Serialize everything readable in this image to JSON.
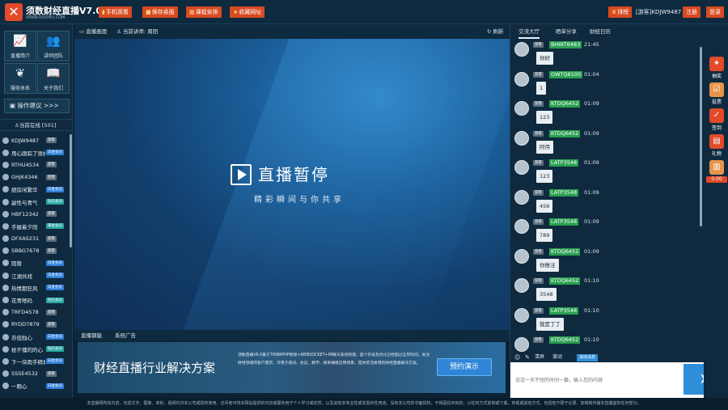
{
  "app": {
    "title": "须数财经直播V7.0",
    "subtitle": "WWW.IXUSHU.COM"
  },
  "topbar": {
    "buttons": [
      {
        "icon": "mobile-icon",
        "label": "手机观看"
      },
      {
        "icon": "save-icon",
        "label": "保存桌面"
      },
      {
        "icon": "calendar-icon",
        "label": "课程安排"
      },
      {
        "icon": "star-icon",
        "label": "收藏网址"
      }
    ],
    "rank_label": "排榜",
    "guest_name": "[游客]KDJW9487",
    "register_label": "注册",
    "login_label": "登录"
  },
  "sidebar": {
    "tiles": [
      {
        "icon": "chart-icon",
        "label": "直播简介"
      },
      {
        "icon": "team-icon",
        "label": "讲师团队"
      },
      {
        "icon": "service-icon",
        "label": "服务体系"
      },
      {
        "icon": "book-icon",
        "label": "关于我们"
      }
    ],
    "suggest_label": "操作建议 >>>",
    "online_label": "当前在线 [501]",
    "users": [
      {
        "name": "KDJW9487",
        "badge": "游客",
        "type": "guest"
      },
      {
        "name": "用心跟踪了很好",
        "badge": "白金会员",
        "type": "vip"
      },
      {
        "name": "RTHU4534",
        "badge": "游客",
        "type": "guest"
      },
      {
        "name": "GHJK4346",
        "badge": "游客",
        "type": "guest"
      },
      {
        "name": "厨房闲繁华",
        "badge": "白金会员",
        "type": "vip"
      },
      {
        "name": "副性与青气",
        "badge": "钻石会员",
        "type": "gold"
      },
      {
        "name": "HBF12342",
        "badge": "游客",
        "type": "guest"
      },
      {
        "name": "手握着夕阳",
        "badge": "黄金会员",
        "type": "gold"
      },
      {
        "name": "DFXAS231",
        "badge": "游客",
        "type": "guest"
      },
      {
        "name": "SBBG7678",
        "badge": "游客",
        "type": "guest"
      },
      {
        "name": "陌陵",
        "badge": "白金会员",
        "type": "vip"
      },
      {
        "name": "江湖共戏",
        "badge": "白金会员",
        "type": "vip"
      },
      {
        "name": "热情期狂风",
        "badge": "白金会员",
        "type": "vip"
      },
      {
        "name": "花青嗯码",
        "badge": "钻石会员",
        "type": "gold"
      },
      {
        "name": "TRFD4578",
        "badge": "游客",
        "type": "guest"
      },
      {
        "name": "RYDD7879",
        "badge": "游客",
        "type": "guest"
      },
      {
        "name": "亦但独心",
        "badge": "白金会员",
        "type": "vip"
      },
      {
        "name": "枕不懂的的心",
        "badge": "钻石会员",
        "type": "gold"
      },
      {
        "name": "下一块雨手精城",
        "badge": "白金会员",
        "type": "vip"
      },
      {
        "name": "SSSE4532",
        "badge": "游客",
        "type": "guest"
      },
      {
        "name": "一颗心",
        "badge": "白金会员",
        "type": "vip"
      }
    ]
  },
  "video": {
    "tab_label": "直播画面",
    "lecturer_label": "当前讲师:",
    "lecturer_name": "周阳",
    "refresh_label": "刷新",
    "paused_title": "直播暂停",
    "paused_subtitle": "精彩瞬间与你共享"
  },
  "bottom_tabs": [
    "直播钢能",
    "系统广告"
  ],
  "banner": {
    "title": "财经直播行业解决方案",
    "description": "须数直播V6.0基于THINKPHP框架+WEBSOCKET+IM聊天系统构建，是个开发及优化已经超过五年时间，关注财经领域的客户需求，可用于培训、会议、教学、喊单播报应用场景，提供灵活易用的财经直播解决方案。",
    "button_label": "预约演示"
  },
  "chat": {
    "tabs": [
      "交流大厅",
      "晒单分享",
      "财经日历"
    ],
    "messages": [
      {
        "tag": "游客",
        "name": "BHWT6483",
        "time": "21:45",
        "text": "你好"
      },
      {
        "tag": "游客",
        "name": "OWTQ8100",
        "time": "01:04",
        "text": "1"
      },
      {
        "tag": "游客",
        "name": "KTDQ6452",
        "time": "01:09",
        "text": "123"
      },
      {
        "tag": "游客",
        "name": "KTDQ6452",
        "time": "01:09",
        "text": "阿伟"
      },
      {
        "tag": "游客",
        "name": "LATP3548",
        "time": "01:09",
        "text": "123"
      },
      {
        "tag": "游客",
        "name": "LATP3548",
        "time": "01:09",
        "text": "456"
      },
      {
        "tag": "游客",
        "name": "LATP3548",
        "time": "01:09",
        "text": "789"
      },
      {
        "tag": "游客",
        "name": "KTDQ6452",
        "time": "01:09",
        "text": "你推注"
      },
      {
        "tag": "游客",
        "name": "KTDQ6452",
        "time": "01:10",
        "text": "3548"
      },
      {
        "tag": "游客",
        "name": "LATP3548",
        "time": "01:10",
        "text": "我是丁丁"
      },
      {
        "tag": "游客",
        "name": "KTDQ6452",
        "time": "01:10",
        "text": ""
      }
    ],
    "tools": [
      "☺",
      "✎",
      "清屏",
      "滚动"
    ],
    "scroll_label": "滚动消息",
    "input_placeholder": "说话一天不短的时间一篇，输入您的内容"
  },
  "rail": [
    {
      "icon": "gift-icon",
      "label": "抽奖",
      "color": "#e24a2a"
    },
    {
      "icon": "vote-icon",
      "label": "投票",
      "color": "#e8934a"
    },
    {
      "icon": "checkin-icon",
      "label": "签到",
      "color": "#e24a2a"
    },
    {
      "icon": "giftbox-icon",
      "label": "礼物",
      "color": "#e24a2a"
    },
    {
      "icon": "wallet-icon",
      "label": "",
      "color": "#e8934a"
    }
  ],
  "rail_count": "0.00",
  "footer": "本直播网所有内容，包括文字、图像、商标、视频均归本公司或授权使用，访问者可将本网站提供的内容或服务用于个人学习或欣赏，以及其他非商业性或非盈利性用途，没有本公司的书面授权，不得因任何目的，以任何方式复制或下载，转载或其他方式，包括但不限于记录、复制和传播本直播室的任何部分。"
}
